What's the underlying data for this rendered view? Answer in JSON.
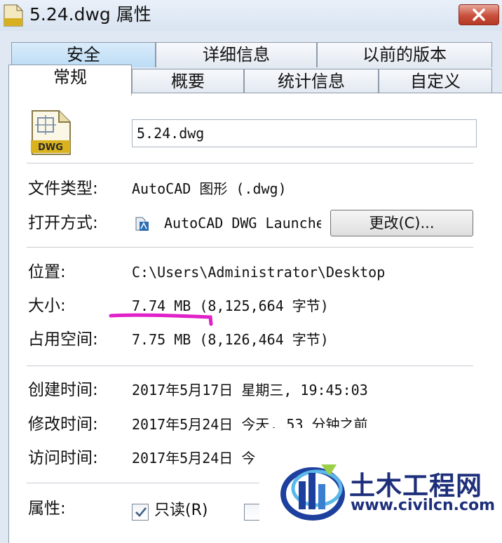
{
  "window": {
    "title": "5.24.dwg 属性",
    "close_icon": "close-icon"
  },
  "tabs": {
    "row1": [
      "安全",
      "详细信息",
      "以前的版本"
    ],
    "row2": [
      "常规",
      "概要",
      "统计信息",
      "自定义"
    ],
    "active": "常规"
  },
  "file": {
    "name": "5.24.dwg",
    "icon": "dwg-file-icon",
    "icon_label": "DWG"
  },
  "general": {
    "type_label": "文件类型:",
    "type_value": "AutoCAD 图形 (.dwg)",
    "opens_with_label": "打开方式:",
    "opens_with_value": "AutoCAD DWG Launche",
    "change_button": "更改(C)...",
    "location_label": "位置:",
    "location_value": "C:\\Users\\Administrator\\Desktop",
    "size_label": "大小:",
    "size_value": "7.74 MB (8,125,664 字节)",
    "size_on_disk_label": "占用空间:",
    "size_on_disk_value": "7.75 MB (8,126,464 字节)",
    "created_label": "创建时间:",
    "created_value": "2017年5月17日 星期三, 19:45:03",
    "modified_label": "修改时间:",
    "modified_value": "2017年5月24日 今天, 53 分钟之前",
    "accessed_label": "访问时间:",
    "accessed_value": "2017年5月24日 今",
    "attributes_label": "属性:",
    "readonly_label": "只读(R)",
    "readonly_checked": true
  },
  "annotation": {
    "underline_color": "#e020c8"
  },
  "watermark": {
    "title": "土木工程网",
    "url": "www.civilcn.com"
  },
  "colors": {
    "accent_tab": "#c7e2f7",
    "close": "#c9503c",
    "wm": "#1d2f7a"
  }
}
